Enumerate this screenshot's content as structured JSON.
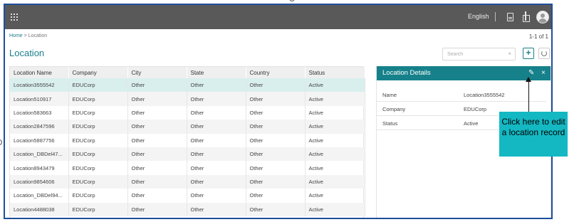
{
  "topbar": {
    "language": "English",
    "icons": [
      "apps-icon",
      "document-icon",
      "gift-icon",
      "user-avatar-icon"
    ]
  },
  "breadcrumb": {
    "home": "Home",
    "separator": ">",
    "current": "Location"
  },
  "pager": "1-1 of 1",
  "page_title": "Location",
  "search": {
    "placeholder": "Search",
    "clear": "×"
  },
  "toolbar": {
    "add": "+"
  },
  "table": {
    "columns": [
      "Location Name",
      "Company",
      "City",
      "State",
      "Country",
      "Status"
    ],
    "rows": [
      [
        "Location3555542",
        "EDUCorp",
        "Other",
        "Other",
        "Other",
        "Active"
      ],
      [
        "Location510917",
        "EDUCorp",
        "Other",
        "Other",
        "Other",
        "Active"
      ],
      [
        "Location583663",
        "EDUCorp",
        "Other",
        "Other",
        "Other",
        "Active"
      ],
      [
        "Location2847596",
        "EDUCorp",
        "Other",
        "Other",
        "Other",
        "Active"
      ],
      [
        "Location5887756",
        "EDUCorp",
        "Other",
        "Other",
        "Other",
        "Active"
      ],
      [
        "Location_DBDel47...",
        "EDUCorp",
        "Other",
        "Other",
        "Other",
        "Active"
      ],
      [
        "Location8943479",
        "EDUCorp",
        "Other",
        "Other",
        "Other",
        "Active"
      ],
      [
        "Location9854606",
        "EDUCorp",
        "Other",
        "Other",
        "Other",
        "Active"
      ],
      [
        "Location_DBDel94...",
        "EDUCorp",
        "Other",
        "Other",
        "Other",
        "Active"
      ],
      [
        "Location4488038",
        "EDUCorp",
        "Other",
        "Other",
        "Other",
        "Active"
      ]
    ]
  },
  "details": {
    "title": "Location Details",
    "edit": "✎",
    "close": "×",
    "fields": [
      {
        "label": "Name",
        "value": "Location3555542"
      },
      {
        "label": "Company",
        "value": "EDUCorp"
      },
      {
        "label": "Status",
        "value": "Active"
      }
    ]
  },
  "callout": {
    "text": "Click here to edit a location record",
    "color": "#14b8c2"
  },
  "colors": {
    "accent": "#16818a",
    "topbar": "#595959",
    "frame": "#1f4e9b"
  }
}
